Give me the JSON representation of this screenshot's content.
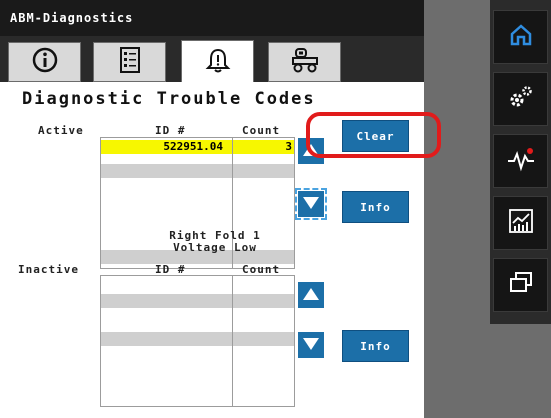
{
  "app": {
    "title": "ABM-Diagnostics"
  },
  "tabs": [
    {
      "icon": "info-icon",
      "active": false
    },
    {
      "icon": "checklist-icon",
      "active": false
    },
    {
      "icon": "alert-bell-icon",
      "active": true
    },
    {
      "icon": "machine-icon",
      "active": false
    }
  ],
  "section": {
    "title": "Diagnostic Trouble Codes"
  },
  "active": {
    "label": "Active",
    "col_id": "ID #",
    "col_count": "Count",
    "rows": [
      {
        "id": "522951.04",
        "count": "3",
        "highlighted": true
      },
      {
        "id": "",
        "count": ""
      },
      {
        "id": "",
        "count": ""
      },
      {
        "id": "",
        "count": ""
      },
      {
        "id": "",
        "count": ""
      }
    ],
    "clear_label": "Clear",
    "info_label": "Info"
  },
  "fault_description": {
    "line1": "Right Fold 1",
    "line2": "Voltage Low"
  },
  "inactive": {
    "label": "Inactive",
    "col_id": "ID #",
    "col_count": "Count",
    "info_label": "Info"
  },
  "sidebar": {
    "items": [
      {
        "icon": "home-icon"
      },
      {
        "icon": "settings-gears-icon"
      },
      {
        "icon": "diagnostics-pulse-icon"
      },
      {
        "icon": "performance-chart-icon"
      },
      {
        "icon": "window-switch-icon"
      }
    ]
  },
  "colors": {
    "accent_blue": "#1c6fa8",
    "highlight_yellow": "#f7f700",
    "annotation_red": "#e11b1b",
    "sidebar_icon_blue": "#2f8de0"
  }
}
